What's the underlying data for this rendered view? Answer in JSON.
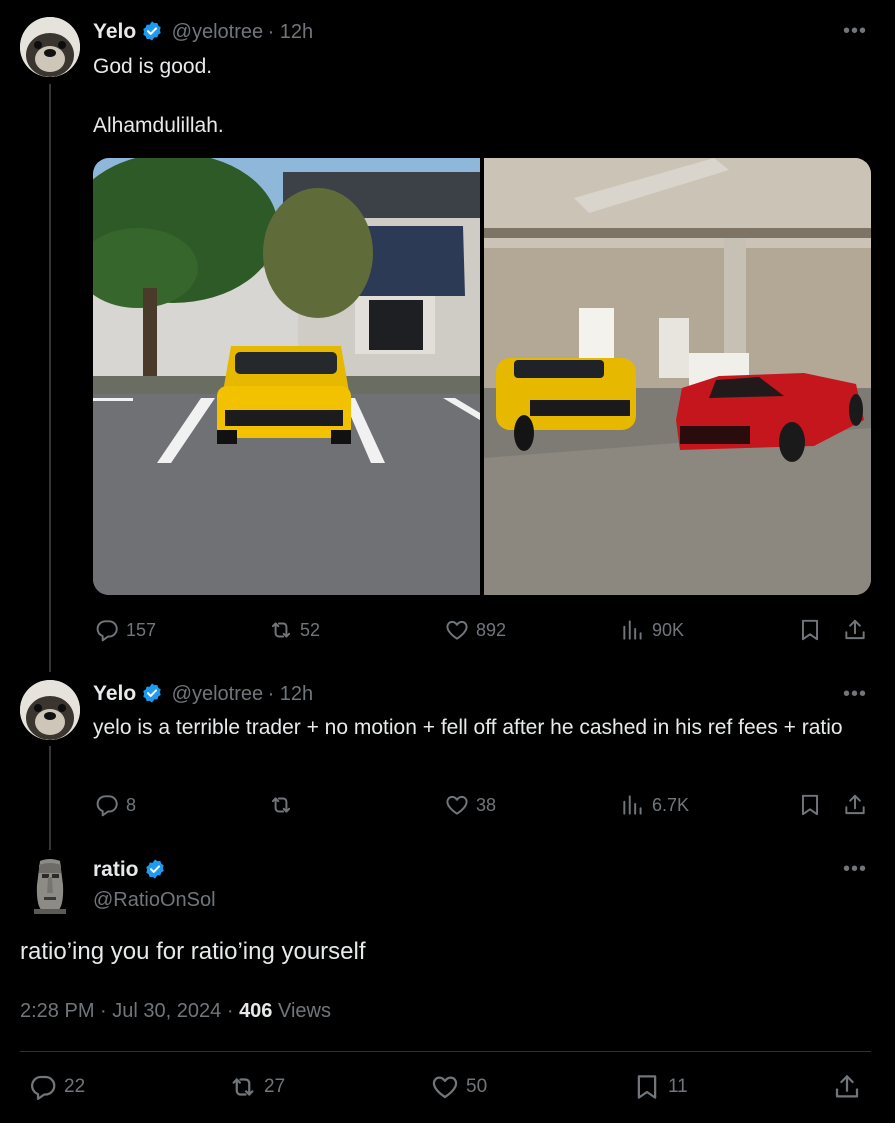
{
  "post1": {
    "name": "Yelo",
    "handle": "@yelotree",
    "time": "· 12h",
    "line1": "God is good.",
    "line2": "Alhamdulillah.",
    "stats": {
      "replies": "157",
      "reposts": "52",
      "likes": "892",
      "views": "90K"
    }
  },
  "post2": {
    "name": "Yelo",
    "handle": "@yelotree",
    "time": "· 12h",
    "text": "yelo is a terrible trader + no motion + fell off after he cashed in his ref fees + ratio",
    "stats": {
      "replies": "8",
      "reposts": "",
      "likes": "38",
      "views": "6.7K"
    }
  },
  "main": {
    "name": "ratio",
    "handle": "@RatioOnSol",
    "text": "ratio’ing you for ratio’ing yourself",
    "time": "2:28 PM",
    "date": "Jul 30, 2024",
    "views_count": "406",
    "views_label": "Views",
    "stats": {
      "replies": "22",
      "reposts": "27",
      "likes": "50",
      "bookmarks": "11"
    }
  },
  "more_glyph": "•••",
  "colors": {
    "background": "#000000",
    "text": "#e7e9ea",
    "muted": "#71767b",
    "verified": "#1d9bf0",
    "divider": "#2f3336"
  },
  "icons": [
    "verified-badge-icon",
    "more-icon",
    "reply-icon",
    "repost-icon",
    "like-icon",
    "views-icon",
    "bookmark-icon",
    "share-icon"
  ]
}
